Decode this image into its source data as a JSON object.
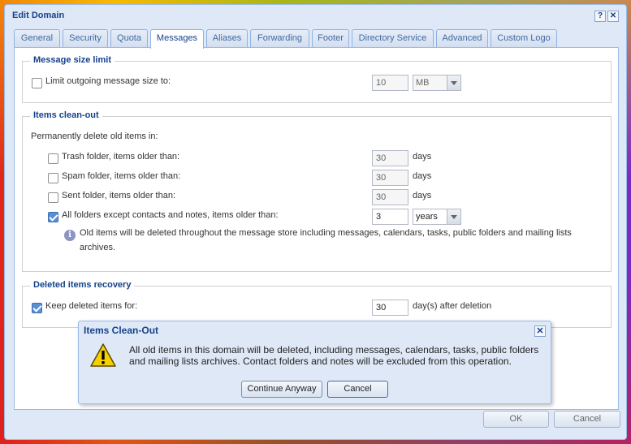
{
  "window": {
    "title": "Edit Domain",
    "help_glyph": "?",
    "close_glyph": "✕"
  },
  "tabs": [
    {
      "label": "General"
    },
    {
      "label": "Security"
    },
    {
      "label": "Quota"
    },
    {
      "label": "Messages",
      "active": true
    },
    {
      "label": "Aliases"
    },
    {
      "label": "Forwarding"
    },
    {
      "label": "Footer"
    },
    {
      "label": "Directory Service"
    },
    {
      "label": "Advanced"
    },
    {
      "label": "Custom Logo"
    }
  ],
  "message_size": {
    "legend": "Message size limit",
    "limit_label": "Limit outgoing message size to:",
    "limit_checked": false,
    "limit_value": "10",
    "limit_unit": "MB"
  },
  "cleanout": {
    "legend": "Items clean-out",
    "intro": "Permanently delete old items in:",
    "trash_label": "Trash folder, items older than:",
    "trash_checked": false,
    "trash_value": "30",
    "trash_unit": "days",
    "spam_label": "Spam folder, items older than:",
    "spam_checked": false,
    "spam_value": "30",
    "spam_unit": "days",
    "sent_label": "Sent folder, items older than:",
    "sent_checked": false,
    "sent_value": "30",
    "sent_unit": "days",
    "all_label": "All folders except contacts and notes, items older than:",
    "all_checked": true,
    "all_value": "3",
    "all_unit": "years",
    "info_glyph": "i",
    "info_line1": "Old items will be deleted throughout the message store including messages, calendars, tasks, public folders and mailing lists",
    "info_line2": "archives."
  },
  "recovery": {
    "legend": "Deleted items recovery",
    "keep_label": "Keep deleted items for:",
    "keep_checked": true,
    "keep_value": "30",
    "keep_unit": "day(s) after deletion"
  },
  "footer": {
    "ok_label": "OK",
    "cancel_label": "Cancel"
  },
  "dialog": {
    "title": "Items Clean-Out",
    "close_glyph": "✕",
    "message_line1": "All old items in this domain will be deleted, including messages, calendars, tasks, public folders",
    "message_line2": "and mailing lists archives. Contact folders and notes will be excluded from this operation.",
    "continue_label": "Continue Anyway",
    "cancel_label": "Cancel"
  },
  "colors": {
    "accent": "#15428b",
    "window_bg": "#dfe8f6",
    "border": "#99bbe8",
    "checkbox_checked": "#5a8fd6",
    "warning_yellow": "#f7d000"
  }
}
